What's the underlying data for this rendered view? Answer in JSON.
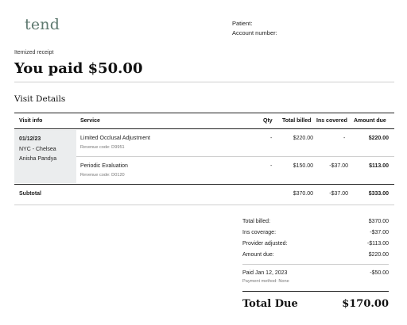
{
  "logo": "tend",
  "header": {
    "patient_label": "Patient:",
    "account_label": "Account number:"
  },
  "receipt_type": "Itemized receipt",
  "headline": "You paid $50.00",
  "section_title": "Visit Details",
  "table": {
    "columns": [
      "Visit info",
      "Service",
      "Qty",
      "Total billed",
      "Ins covered",
      "Amount due"
    ],
    "visit": {
      "date": "01/12/23",
      "location": "NYC - Chelsea",
      "provider": "Anisha Pandya"
    },
    "rows": [
      {
        "service": "Limited Occlusal Adjustment",
        "code": "Revenue code: D9951",
        "qty": "-",
        "total_billed": "$220.00",
        "ins_covered": "-",
        "amount_due": "$220.00"
      },
      {
        "service": "Periodic Evaluation",
        "code": "Revenue code: D0120",
        "qty": "-",
        "total_billed": "$150.00",
        "ins_covered": "-$37.00",
        "amount_due": "$113.00"
      }
    ],
    "subtotal": {
      "label": "Subtotal",
      "total_billed": "$370.00",
      "ins_covered": "-$37.00",
      "amount_due": "$333.00"
    }
  },
  "summary": {
    "lines": [
      {
        "label": "Total billed:",
        "value": "$370.00"
      },
      {
        "label": "Ins coverage:",
        "value": "-$37.00"
      },
      {
        "label": "Provider adjusted:",
        "value": "-$113.00"
      },
      {
        "label": "Amount due:",
        "value": "$220.00"
      }
    ],
    "payment": {
      "label": "Paid Jan 12, 2023",
      "value": "-$50.00",
      "method": "Payment method: None"
    },
    "total_label": "Total Due",
    "total_value": "$170.00"
  }
}
